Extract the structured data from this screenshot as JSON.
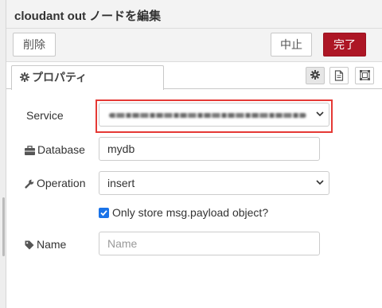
{
  "dialog": {
    "title": "cloudant out ノードを編集"
  },
  "toolbar": {
    "delete_label": "削除",
    "cancel_label": "中止",
    "done_label": "完了"
  },
  "tabs": {
    "properties_label": "プロパティ"
  },
  "icons": {
    "gear": "gear-icon",
    "document": "document-icon",
    "frame": "frame-icon",
    "briefcase": "briefcase-icon",
    "wrench": "wrench-icon",
    "tag": "tag-icon",
    "chevron": "chevron-down-icon"
  },
  "form": {
    "service": {
      "label": "Service"
    },
    "database": {
      "label": "Database",
      "value": "mydb"
    },
    "operation": {
      "label": "Operation",
      "value": "insert"
    },
    "payload_only": {
      "label": "Only store msg.payload object?",
      "checked": true
    },
    "name": {
      "label": "Name",
      "placeholder": "Name"
    }
  },
  "colors": {
    "done_button": "#ad1625",
    "highlight": "#e53935",
    "checkbox": "#1a73e8"
  }
}
